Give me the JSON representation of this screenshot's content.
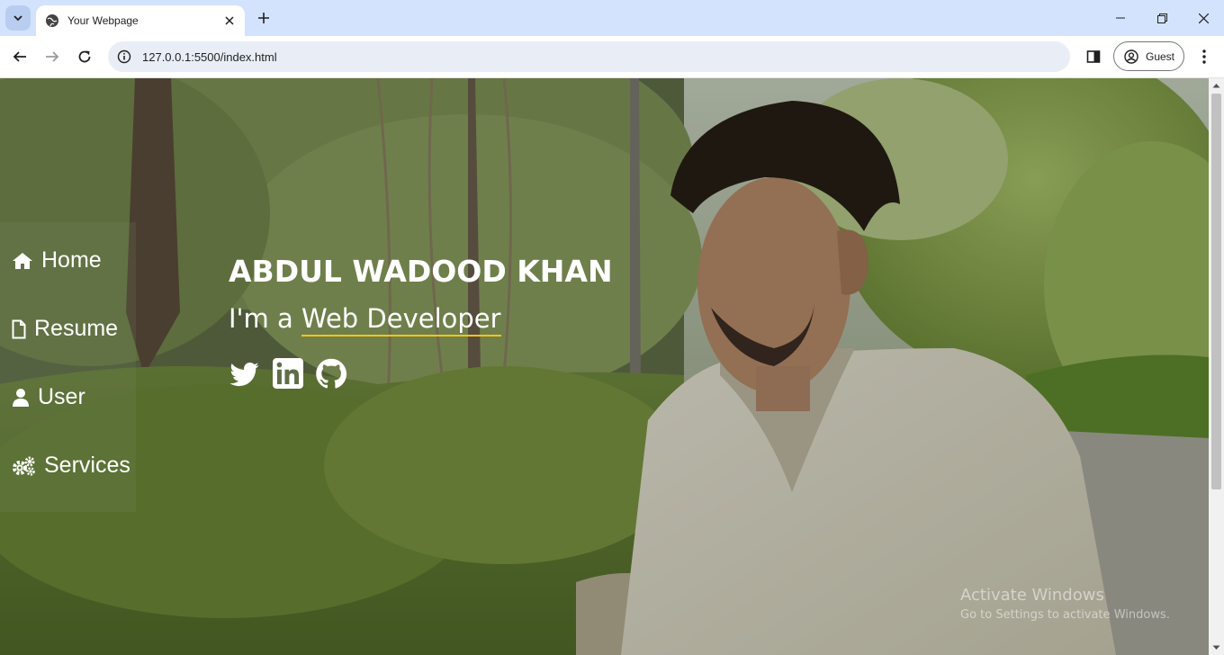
{
  "browser": {
    "tab_title": "Your Webpage",
    "url": "127.0.0.1:5500/index.html",
    "profile_label": "Guest",
    "icons": {
      "tab_search": "chevron-down-icon",
      "favicon": "globe-icon",
      "tab_close": "close-icon",
      "new_tab": "plus-icon",
      "minimize": "minimize-icon",
      "restore": "restore-icon",
      "close_window": "close-icon",
      "back": "arrow-left-icon",
      "forward": "arrow-right-icon",
      "reload": "reload-icon",
      "site_info": "info-icon",
      "side_panel": "side-panel-icon",
      "profile": "user-circle-icon",
      "menu": "kebab-menu-icon"
    }
  },
  "sidebar": {
    "items": [
      {
        "label": "Home",
        "icon": "home-icon"
      },
      {
        "label": "Resume",
        "icon": "file-icon"
      },
      {
        "label": "User",
        "icon": "user-icon"
      },
      {
        "label": "Services",
        "icon": "cogs-icon"
      }
    ]
  },
  "hero": {
    "name": "ABDUL WADOOD KHAN",
    "role_prefix": "I'm a ",
    "role_typed": "Web Developer",
    "underline_color": "#f5c518",
    "social": [
      {
        "name": "twitter-icon"
      },
      {
        "name": "linkedin-icon"
      },
      {
        "name": "github-icon"
      }
    ]
  },
  "watermark": {
    "line1": "Activate Windows",
    "line2": "Go to Settings to activate Windows."
  },
  "colors": {
    "titlebar": "#d3e3fd",
    "omnibox": "#e9eef6"
  }
}
